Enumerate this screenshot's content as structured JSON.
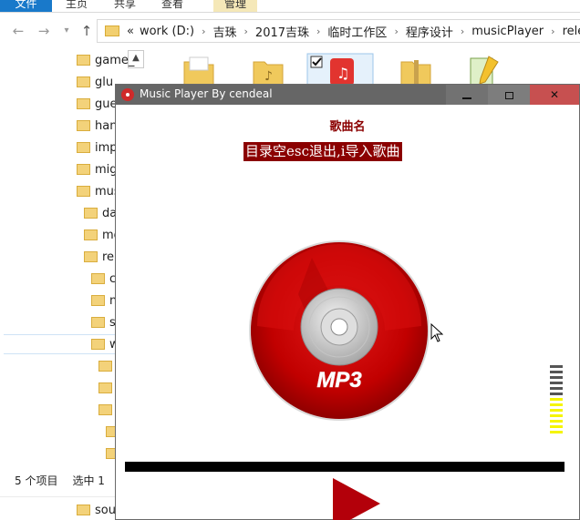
{
  "explorer": {
    "ribbon_tabs": [
      "文件",
      "主页",
      "共享",
      "查看",
      "管理"
    ],
    "breadcrumb": [
      "work (D:)",
      "吉珠",
      "2017吉珠",
      "临时工作区",
      "程序设计",
      "musicPlayer",
      "releas"
    ],
    "breadcrumb_prefix": "«",
    "tree": [
      "game_",
      "glu",
      "gue",
      "han",
      "imp",
      "mig",
      "mus",
      "da",
      "mo",
      "re",
      "c",
      "n",
      "s",
      "w",
      "",
      "",
      "",
      "",
      "",
      "sou"
    ],
    "status_count": "5 个项目",
    "status_selected": "选中 1"
  },
  "player": {
    "title": "Music Player By cendeal",
    "song_name": "歌曲名",
    "hint": "目录空esc退出,i导入歌曲",
    "disc_label": "MP3",
    "progress": 0,
    "level_bars": [
      "#555555",
      "#555555",
      "#555555",
      "#555555",
      "#555555",
      "#555555",
      "#f5f500",
      "#f5f500",
      "#f5f500",
      "#f5f500",
      "#f5f500",
      "#f5f500",
      "#f5f500"
    ],
    "colors": {
      "title_text": "#8b0000",
      "hint_bg": "#8b0000",
      "disc": "#c40000",
      "play_button": "#b3000a",
      "progress_track": "#000000"
    }
  }
}
